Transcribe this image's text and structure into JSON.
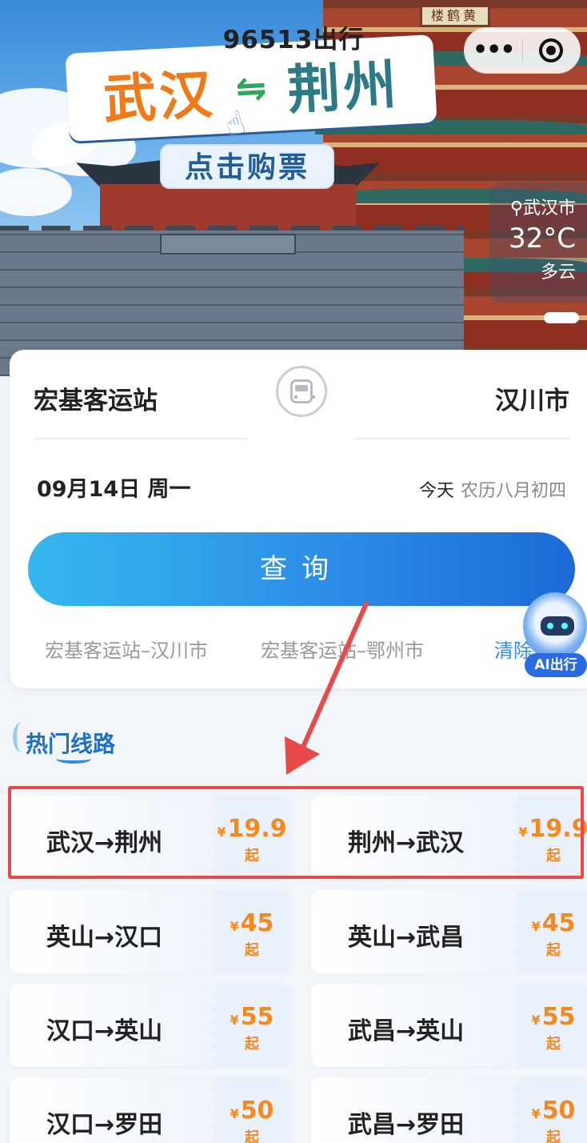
{
  "app": {
    "title": "96513出行"
  },
  "capsule": {
    "more_icon": "more-dots-icon",
    "close_icon": "target-icon",
    "more_label": "•••"
  },
  "banner": {
    "city_from": "武汉",
    "city_to": "荆州",
    "swap_glyph": "⇋",
    "buy_label": "点击购票",
    "plaque": "楼鹤黄"
  },
  "weather": {
    "location": "武汉市",
    "temperature": "32°C",
    "condition": "多云"
  },
  "search": {
    "from_station": "宏基客运站",
    "to_station": "汉川市",
    "date": "09月14日 周一",
    "today": "今天",
    "lunar": "农历八月初四",
    "query_label": "查询",
    "history": [
      "宏基客运站–汉川市",
      "宏基客运站–鄂州市"
    ],
    "clear_label": "清除"
  },
  "ai": {
    "label": "AI出行"
  },
  "hot": {
    "title": "热门线路",
    "currency": "¥",
    "from_suffix": "起",
    "routes": [
      {
        "name": "武汉→荆州",
        "price": "19.9"
      },
      {
        "name": "荆州→武汉",
        "price": "19.9"
      },
      {
        "name": "英山→汉口",
        "price": "45"
      },
      {
        "name": "英山→武昌",
        "price": "45"
      },
      {
        "name": "汉口→英山",
        "price": "55"
      },
      {
        "name": "武昌→英山",
        "price": "55"
      },
      {
        "name": "汉口→罗田",
        "price": "50"
      },
      {
        "name": "武昌→罗田",
        "price": "50"
      }
    ]
  },
  "colors": {
    "accent": "#2c8ee6",
    "price": "#f5891e",
    "highlight": "#e84a4a"
  }
}
